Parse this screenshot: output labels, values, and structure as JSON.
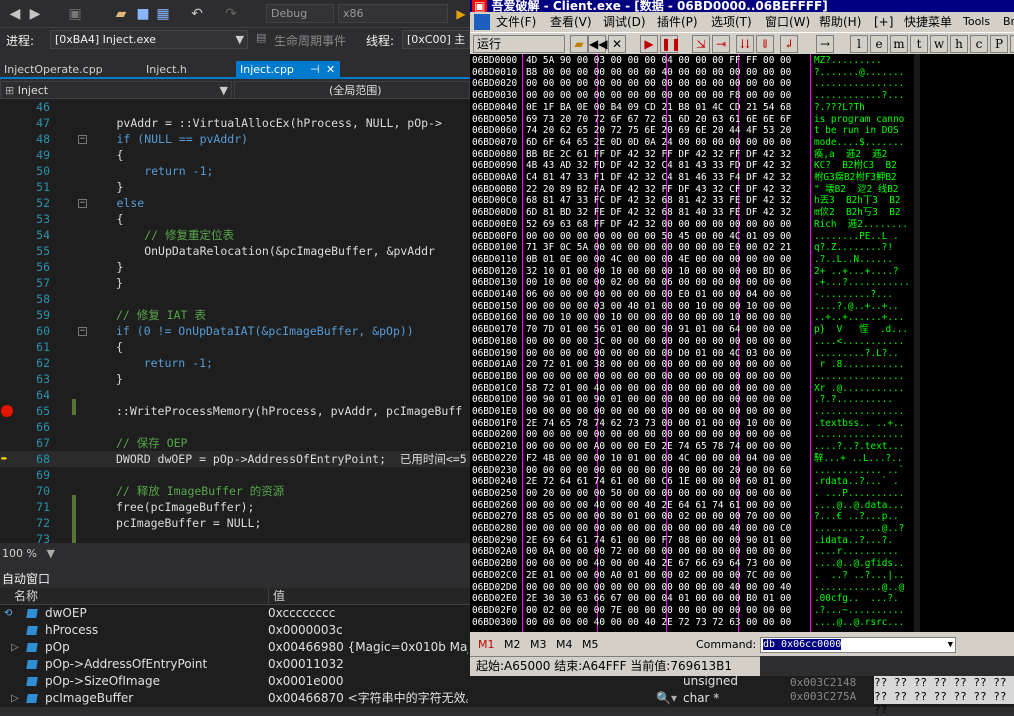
{
  "vs": {
    "toolbar": {
      "config": "Debug",
      "platform": "x86"
    },
    "process_bar": {
      "process_label": "进程:",
      "process_value": "[0xBA4] Inject.exe",
      "lifecycle_label": "生命周期事件",
      "thread_label": "线程:",
      "thread_value": "[0xC00] 主"
    },
    "tabs": [
      {
        "label": "InjectOperate.cpp"
      },
      {
        "label": "Inject.h"
      },
      {
        "label": "Inject.cpp"
      }
    ],
    "nav": {
      "project": "Inject",
      "scope": "(全局范围)"
    },
    "code": [
      {
        "n": "46",
        "t": ""
      },
      {
        "n": "47",
        "t": "pvAddr = ::VirtualAllocEx(hProcess, NULL, pOp->"
      },
      {
        "n": "48",
        "t": "if (NULL == pvAddr)"
      },
      {
        "n": "49",
        "t": "{"
      },
      {
        "n": "50",
        "t": "    return -1;"
      },
      {
        "n": "51",
        "t": "}"
      },
      {
        "n": "52",
        "t": "else"
      },
      {
        "n": "53",
        "t": "{"
      },
      {
        "n": "54",
        "t": "    // 修复重定位表"
      },
      {
        "n": "55",
        "t": "    OnUpDataRelocation(&pcImageBuffer, &pvAddr"
      },
      {
        "n": "56",
        "t": "}"
      },
      {
        "n": "57",
        "t": "}"
      },
      {
        "n": "58",
        "t": ""
      },
      {
        "n": "59",
        "t": "// 修复 IAT 表"
      },
      {
        "n": "60",
        "t": "if (0 != OnUpDataIAT(&pcImageBuffer, &pOp))"
      },
      {
        "n": "61",
        "t": "{"
      },
      {
        "n": "62",
        "t": "    return -1;"
      },
      {
        "n": "63",
        "t": "}"
      },
      {
        "n": "64",
        "t": ""
      },
      {
        "n": "65",
        "t": "::WriteProcessMemory(hProcess, pvAddr, pcImageBuff"
      },
      {
        "n": "66",
        "t": ""
      },
      {
        "n": "67",
        "t": "// 保存 OEP"
      },
      {
        "n": "68",
        "t": "DWORD dwOEP = pOp->AddressOfEntryPoint;  已用时间<=5"
      },
      {
        "n": "69",
        "t": ""
      },
      {
        "n": "70",
        "t": "// 释放 ImageBuffer 的资源"
      },
      {
        "n": "71",
        "t": "free(pcImageBuffer);"
      },
      {
        "n": "72",
        "t": "pcImageBuffer = NULL;"
      },
      {
        "n": "73",
        "t": ""
      }
    ],
    "zoom": "100 %",
    "autos": {
      "title": "自动窗口",
      "col_name": "名称",
      "col_value": "值",
      "rows": [
        {
          "name": "dwOEP",
          "value": "0xcccccccc",
          "type": ""
        },
        {
          "name": "hProcess",
          "value": "0x0000003c",
          "type": ""
        },
        {
          "name": "pOp",
          "value": "0x00466980 {Magic=0x010b MajorLink",
          "type": ""
        },
        {
          "name": "pOp->AddressOfEntryPoint",
          "value": "0x00011032",
          "type": ""
        },
        {
          "name": "pOp->SizeOfImage",
          "value": "0x0001e000",
          "type": "unsigned"
        },
        {
          "name": "pcImageBuffer",
          "value": "0x00466870 <字符串中的字符无效。>",
          "type": "char *"
        }
      ]
    }
  },
  "od": {
    "title": "吾爱破解 - Client.exe - [数据 - 06BD0000..06BEFFFF]",
    "menu": [
      "文件(F)",
      "查看(V)",
      "调试(D)",
      "插件(P)",
      "选项(T)",
      "窗口(W)",
      "帮助(H)",
      "[+]",
      "快捷菜单",
      "Tools",
      "Br"
    ],
    "run_state": "运行",
    "toolbar_letters": [
      "l",
      "e",
      "m",
      "t",
      "w",
      "h",
      "c",
      "P",
      "k"
    ],
    "dump": [
      {
        "a": "06BD0000",
        "h": "4D 5A 90 00 03 00 00 00 04 00 00 00 FF FF 00 00",
        "t": "MZ?........."
      },
      {
        "a": "06BD0010",
        "h": "B8 00 00 00 00 00 00 00 40 00 00 00 00 00 00 00",
        "t": "?.......@......."
      },
      {
        "a": "06BD0020",
        "h": "00 00 00 00 00 00 00 00 00 00 00 00 00 00 00 00",
        "t": "................"
      },
      {
        "a": "06BD0030",
        "h": "00 00 00 00 00 00 00 00 00 00 00 00 F8 00 00 00",
        "t": "............?..."
      },
      {
        "a": "06BD0040",
        "h": "0E 1F BA 0E 00 B4 09 CD 21 B8 01 4C CD 21 54 68",
        "t": "?.???L?Th"
      },
      {
        "a": "06BD0050",
        "h": "69 73 20 70 72 6F 67 72 61 6D 20 63 61 6E 6E 6F",
        "t": "is program canno"
      },
      {
        "a": "06BD0060",
        "h": "74 20 62 65 20 72 75 6E 20 69 6E 20 44 4F 53 20",
        "t": "t be run in DOS "
      },
      {
        "a": "06BD0070",
        "h": "6D 6F 64 65 2E 0D 0D 0A 24 00 00 00 00 00 00 00",
        "t": "mode....$......."
      },
      {
        "a": "06BD0080",
        "h": "BB BE 2C 61 FF DF 42 32 FF DF 42 32 FF DF 42 32",
        "t": "痪,a  逓2  逓2  "
      },
      {
        "a": "06BD0090",
        "h": "4B 43 AD 32 FD DF 42 32 C4 81 43 33 FD DF 42 32",
        "t": "KC?  B2柎C3  B2"
      },
      {
        "a": "06BD00A0",
        "h": "C4 81 47 33 F1 DF 42 32 C4 81 46 33 F4 DF 42 32",
        "t": "柎G3瘸B2柎F3魻B2"
      },
      {
        "a": "06BD00B0",
        "h": "22 20 89 B2 FA DF 42 32 FF DF 43 32 CF DF 42 32",
        "t": "\" 壊B2  逤2 线B2"
      },
      {
        "a": "06BD00C0",
        "h": "68 81 47 33 FC DF 42 32 68 81 42 33 FE DF 42 32",
        "t": "h丟3  B2h丅3  B2"
      },
      {
        "a": "06BD00D0",
        "h": "6D 81 BD 32 FE DF 42 32 68 81 40 33 FE DF 42 32",
        "t": "m佽2  B2h丂3  B2"
      },
      {
        "a": "06BD00E0",
        "h": "52 69 63 68 FF DF 42 32 00 00 00 00 00 00 00 00",
        "t": "Rich  逓2........"
      },
      {
        "a": "06BD00F0",
        "h": "00 00 00 00 00 00 00 00 50 45 00 00 4C 01 09 00",
        "t": "........PE..L ."
      },
      {
        "a": "06BD0100",
        "h": "71 3F 0C 5A 00 00 00 00 00 00 00 00 E0 00 02 21",
        "t": "q?.Z........?!"
      },
      {
        "a": "06BD0110",
        "h": "0B 01 0E 00 00 4C 00 00 00 4E 00 00 00 00 00 00",
        "t": ".?..L..N......"
      },
      {
        "a": "06BD0120",
        "h": "32 10 01 00 00 10 00 00 00 10 00 00 00 00 BD 06",
        "t": "2+ ..+...+....?"
      },
      {
        "a": "06BD0130",
        "h": "00 10 00 00 00 02 00 00 06 00 00 00 00 00 00 00",
        "t": ".+...?..........."
      },
      {
        "a": "06BD0140",
        "h": "06 00 00 00 00 00 00 00 00 E0 01 00 00 04 00 00",
        "t": "-.........?..."
      },
      {
        "a": "06BD0150",
        "h": "00 00 00 00 03 00 40 01 00 00 10 00 00 10 00 00",
        "t": "....?.@..+..+.."
      },
      {
        "a": "06BD0160",
        "h": "00 00 10 00 00 10 00 00 00 00 00 00 10 00 00 00",
        "t": "..+..+......+..."
      },
      {
        "a": "06BD0170",
        "h": "70 7D 01 00 56 01 00 00 90 91 01 00 64 00 00 00",
        "t": "p}  V   悜  .d..."
      },
      {
        "a": "06BD0180",
        "h": "00 00 00 00 3C 00 00 00 00 00 00 00 00 00 00 00",
        "t": "....<..........."
      },
      {
        "a": "06BD0190",
        "h": "00 00 00 00 00 00 00 00 00 D0 01 00 4C 03 00 00",
        "t": ".........?.L?.."
      },
      {
        "a": "06BD01A0",
        "h": "20 72 01 00 38 00 00 00 00 00 00 00 00 00 00 00",
        "t": " r .8..........."
      },
      {
        "a": "06BD01B0",
        "h": "00 00 00 00 00 00 00 00 00 00 00 00 00 00 00 00",
        "t": "................"
      },
      {
        "a": "06BD01C0",
        "h": "58 72 01 00 40 00 00 00 00 00 00 00 00 00 00 00",
        "t": "Xr .@..........."
      },
      {
        "a": "06BD01D0",
        "h": "00 90 01 00 90 01 00 00 00 00 00 00 00 00 00 00",
        "t": ".?.?.........."
      },
      {
        "a": "06BD01E0",
        "h": "00 00 00 00 00 00 00 00 00 00 00 00 00 00 00 00",
        "t": "................"
      },
      {
        "a": "06BD01F0",
        "h": "2E 74 65 78 74 62 73 73 00 00 01 00 00 10 00 00",
        "t": ".textbss.. ..+.."
      },
      {
        "a": "06BD0200",
        "h": "00 00 00 00 00 00 00 00 00 00 00 00 00 00 00 00",
        "t": "................"
      },
      {
        "a": "06BD0210",
        "h": "00 00 00 00 A0 00 00 E0 2E 74 65 78 74 00 00 00",
        "t": "....?..?.text..."
      },
      {
        "a": "06BD0220",
        "h": "F2 4B 00 00 00 10 01 00 00 4C 00 00 00 04 00 00",
        "t": "騂...+ ..L...?.."
      },
      {
        "a": "06BD0230",
        "h": "00 00 00 00 00 00 00 00 00 00 00 00 20 00 00 60",
        "t": "............ ..`"
      },
      {
        "a": "06BD0240",
        "h": "2E 72 64 61 74 61 00 00 C6 1E 00 00 00 60 01 00",
        "t": ".rdata..?...` ."
      },
      {
        "a": "06BD0250",
        "h": "00 20 00 00 00 50 00 00 00 00 00 00 00 00 00 00",
        "t": ". ...P.........."
      },
      {
        "a": "06BD0260",
        "h": "00 00 00 00 40 00 00 40 2E 64 61 74 61 00 00 00",
        "t": "....@..@.data..."
      },
      {
        "a": "06BD0270",
        "h": "88 05 00 00 00 80 01 00 00 02 00 00 00 70 00 00",
        "t": "?...€ ..?...p.."
      },
      {
        "a": "06BD0280",
        "h": "00 00 00 00 00 00 00 00 00 00 00 00 40 00 00 C0",
        "t": "............@..?"
      },
      {
        "a": "06BD0290",
        "h": "2E 69 64 61 74 61 00 00 F7 08 00 00 00 90 01 00",
        "t": ".idata..?...?."
      },
      {
        "a": "06BD02A0",
        "h": "00 0A 00 00 00 72 00 00 00 00 00 00 00 00 00 00",
        "t": "....r.........."
      },
      {
        "a": "06BD02B0",
        "h": "00 00 00 00 40 00 00 40 2E 67 66 69 64 73 00 00",
        "t": "....@..@.gfids.."
      },
      {
        "a": "06BD02C0",
        "h": "2E 01 00 00 00 A0 01 00 00 02 00 00 00 7C 00 00",
        "t": ".  ..? ..?...|.."
      },
      {
        "a": "06BD02D0",
        "h": "00 00 00 00 00 00 00 00 00 00 00 00 40 00 00 40",
        "t": "............@..@"
      },
      {
        "a": "06BD02E0",
        "h": "2E 30 30 63 66 67 00 00 04 01 00 00 00 B0 01 00",
        "t": ".00cfg..  ...?."
      },
      {
        "a": "06BD02F0",
        "h": "00 02 00 00 00 7E 00 00 00 00 00 00 00 00 00 00",
        "t": ".?...~.........."
      },
      {
        "a": "06BD0300",
        "h": "00 00 00 00 40 00 00 40 2E 72 73 72 63 00 00 00",
        "t": "....@..@.rsrc..."
      }
    ],
    "cmd": {
      "tabs": [
        "M1",
        "M2",
        "M3",
        "M4",
        "M5"
      ],
      "label": "Command:",
      "value": "db 0x06cc0000"
    },
    "status": "起始:A65000 结束:A64FFF 当前值:769613B1",
    "bottom": [
      {
        "addr": "0x003C2148",
        "bytes": "?? ?? ?? ?? ?? ?? ?? ??"
      },
      {
        "addr": "0x003C275A",
        "bytes": "?? ?? ?? ?? ?? ?? ?? ??"
      }
    ]
  }
}
